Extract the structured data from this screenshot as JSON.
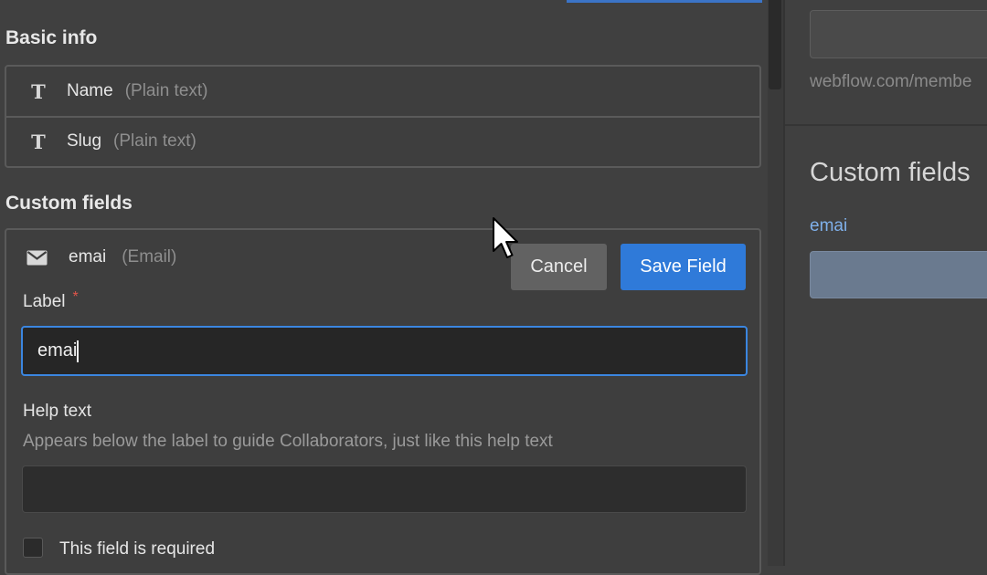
{
  "basic_info": {
    "title": "Basic info",
    "fields": [
      {
        "name": "Name",
        "type": "(Plain text)",
        "icon": "text-type-icon"
      },
      {
        "name": "Slug",
        "type": "(Plain text)",
        "icon": "text-type-icon"
      }
    ]
  },
  "custom_fields": {
    "title": "Custom fields",
    "editing_field": {
      "name": "emai",
      "type": "(Email)",
      "icon": "envelope-icon"
    },
    "cancel_label": "Cancel",
    "save_label": "Save Field",
    "label_title": "Label",
    "required_marker": "*",
    "label_value": "emai",
    "help_title": "Help text",
    "help_description": "Appears below the label to guide Collaborators, just like this help text",
    "help_value": "",
    "required_checkbox_label": "This field is required",
    "required_checked": false
  },
  "right_panel": {
    "url_text": "webflow.com/membe",
    "title": "Custom fields",
    "preview_label": "emai"
  },
  "colors": {
    "accent": "#2f7ad9",
    "required": "#e0554a",
    "link": "#7fb0ea"
  }
}
